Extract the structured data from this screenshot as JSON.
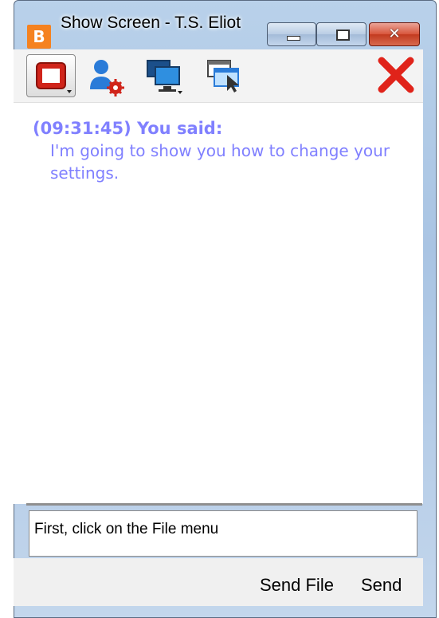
{
  "window": {
    "title": "Show Screen - T.S. Eliot",
    "app_icon_letter": "B",
    "accent": "#f58220"
  },
  "toolbar": {
    "tools": [
      {
        "name": "record-icon",
        "color": "#d0241a"
      },
      {
        "name": "user-settings-icon",
        "color": "#2a7bd8"
      },
      {
        "name": "monitor-icon",
        "color": "#2a7bd8"
      },
      {
        "name": "window-select-icon",
        "color": "#2a7bd8"
      },
      {
        "name": "close-icon",
        "color": "#e0231a"
      }
    ]
  },
  "chat": {
    "messages": [
      {
        "header": "(09:31:45) You said:",
        "text": "I'm going to show you how to change your settings."
      }
    ],
    "color": "#8080ff"
  },
  "input": {
    "value": "First, click on the File menu"
  },
  "actions": {
    "send_file_label": "Send File",
    "send_label": "Send"
  }
}
